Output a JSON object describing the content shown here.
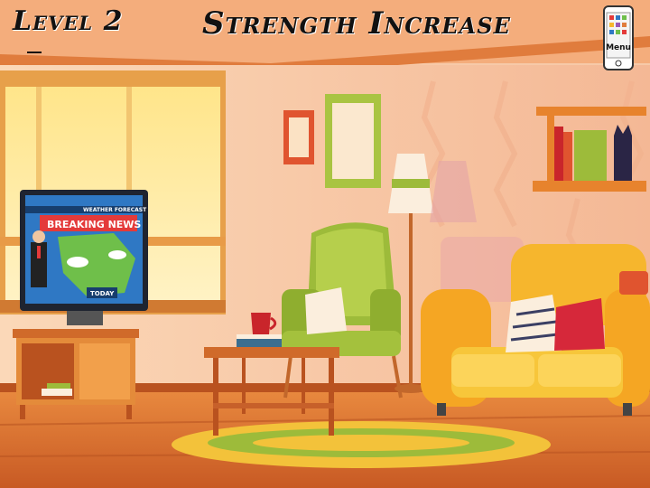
{
  "hud": {
    "level": "Level 2",
    "title": "Strength Increase",
    "menu_label": "Menu"
  },
  "tv": {
    "forecast": "WEATHER FORECAST",
    "breaking": "BREAKING NEWS",
    "today": "TODAY"
  },
  "colors": {
    "wall": "#f7c9a8",
    "floor": "#d9702c",
    "sofa": "#f6b62d",
    "chair": "#9dbb3a",
    "breaking_red": "#e43a3a"
  }
}
